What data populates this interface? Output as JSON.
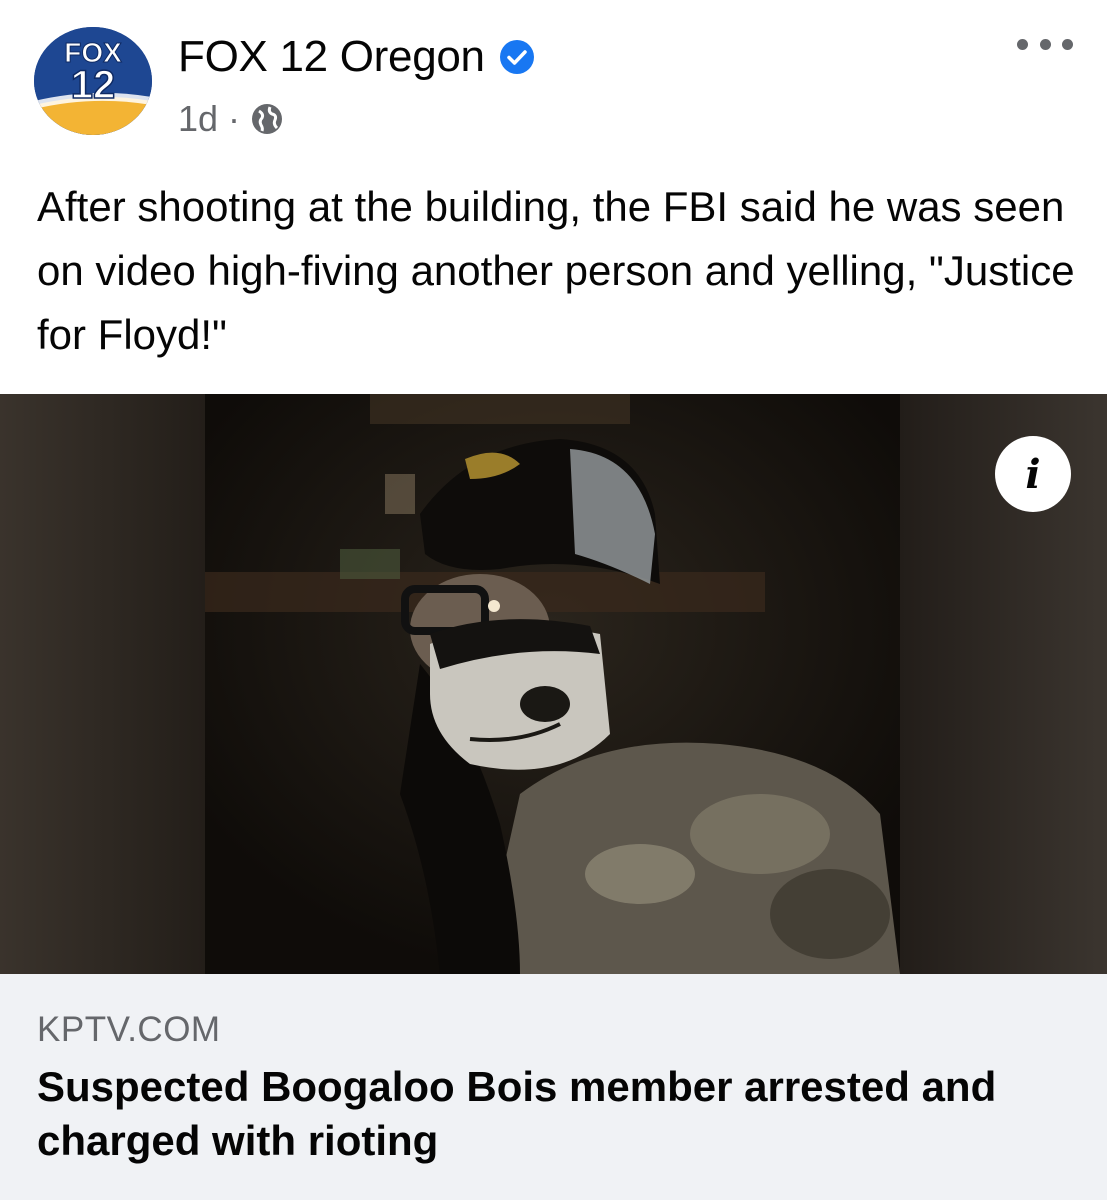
{
  "page": {
    "name": "FOX 12 Oregon",
    "verified": true,
    "time": "1d",
    "separator": "·",
    "audience_icon": "globe-icon",
    "avatar": {
      "line1": "FOX",
      "line2": "12"
    }
  },
  "post": {
    "text": "After shooting at the building, the FBI said he was seen on video high-fiving another person and yelling, \"Justice for Floyd!\""
  },
  "media": {
    "info_label": "i"
  },
  "link": {
    "domain": "KPTV.COM",
    "title": "Suspected Boogaloo Bois member arrested and charged with rioting"
  },
  "colors": {
    "text": "#050505",
    "secondary": "#65676b",
    "verified_blue": "#1877f2",
    "preview_bg": "#f0f2f5"
  }
}
